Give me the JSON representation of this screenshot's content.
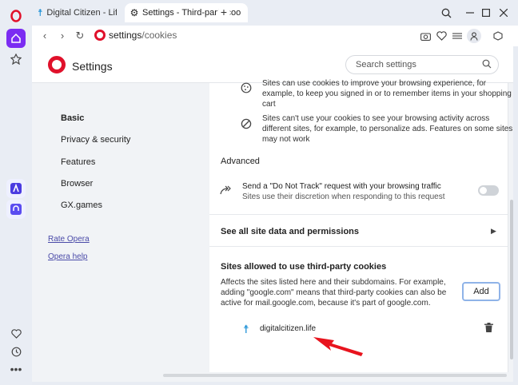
{
  "tabs": [
    {
      "icon": "digitalcitizen-icon",
      "label": "Digital Citizen - Life in a d"
    },
    {
      "icon": "gear-icon",
      "label": "Settings - Third-party coo"
    }
  ],
  "address": {
    "domain": "settings",
    "path": "/cookies"
  },
  "header": {
    "title": "Settings",
    "search_placeholder": "Search settings"
  },
  "nav": {
    "items": [
      "Basic",
      "Privacy & security",
      "Features",
      "Browser",
      "GX.games"
    ],
    "links": [
      "Rate Opera",
      "Opera help"
    ]
  },
  "content": {
    "row1": "Sites can use cookies to improve your browsing experience, for example, to keep you signed in or to remember items in your shopping cart",
    "row2": "Sites can't use your cookies to see your browsing activity across different sites, for example, to personalize ads. Features on some sites may not work",
    "advanced_title": "Advanced",
    "dnt_title": "Send a \"Do Not Track\" request with your browsing traffic",
    "dnt_sub": "Sites use their discretion when responding to this request",
    "see_all": "See all site data and permissions",
    "tp_title": "Sites allowed to use third-party cookies",
    "tp_desc": "Affects the sites listed here and their subdomains. For example, adding \"google.com\" means that third-party cookies can also be active for mail.google.com, because it's part of google.com.",
    "add_label": "Add",
    "site": "digitalcitizen.life"
  },
  "colors": {
    "opera_red": "#e0112b",
    "site_icon": "#1a8fd6",
    "arrow": "#e8141e"
  }
}
